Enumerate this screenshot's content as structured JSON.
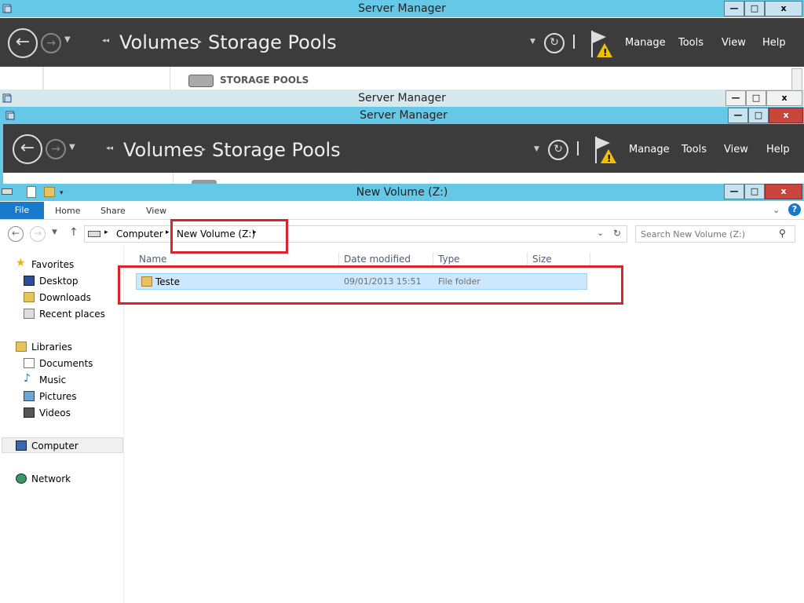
{
  "sm_back": {
    "title": "Server Manager",
    "controls": {
      "minimize": "—",
      "maximize": "□",
      "close": "x"
    },
    "nav": {
      "sep": "◂◂",
      "crumb1": "Volumes",
      "arrow": "▸",
      "crumb2": "Storage Pools"
    },
    "menu": {
      "manage": "Manage",
      "tools": "Tools",
      "view": "View",
      "help": "Help"
    },
    "section_title": "STORAGE POOLS"
  },
  "sm_mid": {
    "title": "Server Manager"
  },
  "sm_front": {
    "title": "Server Manager",
    "nav": {
      "crumb1": "Volumes",
      "crumb2": "Storage Pools"
    },
    "menu": {
      "manage": "Manage",
      "tools": "Tools",
      "view": "View",
      "help": "Help"
    }
  },
  "explorer": {
    "title": "New Volume (Z:)",
    "ribbon_tabs": {
      "file": "File",
      "home": "Home",
      "share": "Share",
      "view": "View"
    },
    "address": {
      "computer": "Computer",
      "volume": "New Volume (Z:)"
    },
    "search_placeholder": "Search New Volume (Z:)",
    "sidebar": {
      "favorites": "Favorites",
      "desktop": "Desktop",
      "downloads": "Downloads",
      "recent": "Recent places",
      "libraries": "Libraries",
      "documents": "Documents",
      "music": "Music",
      "pictures": "Pictures",
      "videos": "Videos",
      "computer": "Computer",
      "network": "Network"
    },
    "columns": {
      "name": "Name",
      "date": "Date modified",
      "type": "Type",
      "size": "Size"
    },
    "files": [
      {
        "name": "Teste",
        "date": "09/01/2013 15:51",
        "type": "File folder",
        "size": ""
      }
    ]
  },
  "colors": {
    "accent": "#64c8e6",
    "sm_dark": "#3c3c3c",
    "highlight_red": "#d9242e",
    "selection": "#cce8ff"
  }
}
